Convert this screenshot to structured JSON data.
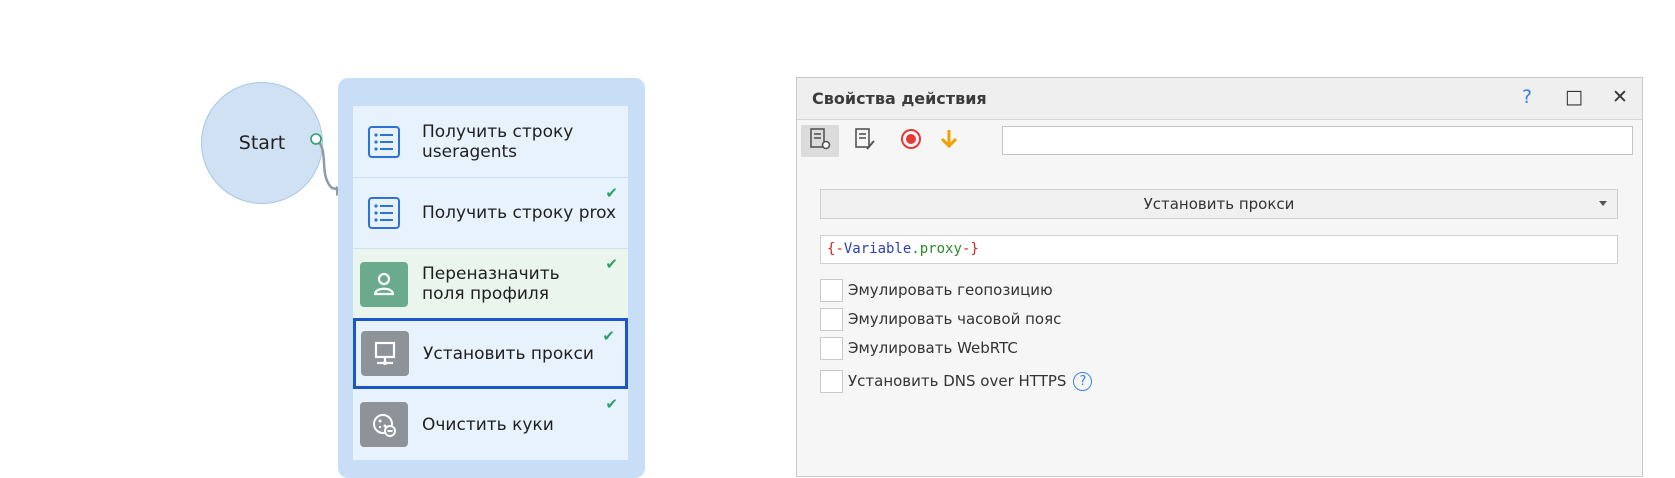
{
  "start": {
    "label": "Start"
  },
  "actions": [
    {
      "label": "Получить строку useragents",
      "icon": "list-icon",
      "checked": false
    },
    {
      "label": "Получить строку prox",
      "icon": "list-icon",
      "checked": true
    },
    {
      "label": "Переназначить поля профиля",
      "icon": "user-icon",
      "checked": true
    },
    {
      "label": "Установить прокси",
      "icon": "monitor-network-icon",
      "checked": true,
      "selected": true
    },
    {
      "label": "Очистить куки",
      "icon": "cookie-icon",
      "checked": true
    }
  ],
  "panel": {
    "title": "Свойства действия",
    "titlebar_buttons": [
      "?",
      "□",
      "✕"
    ],
    "toolbar_input": "",
    "action_select": "Установить прокси",
    "variable": {
      "open": "{-",
      "name": "Variable",
      "dot": ".",
      "prop": "proxy",
      "close": "-}"
    },
    "checkboxes": [
      {
        "label": "Эмулировать геопозицию",
        "checked": false
      },
      {
        "label": "Эмулировать часовой пояс",
        "checked": false
      },
      {
        "label": "Эмулировать WebRTC",
        "checked": false
      },
      {
        "label": "Установить DNS over HTTPS",
        "checked": false,
        "help": "?"
      }
    ]
  },
  "colors": {
    "accent": "#1a56c9",
    "check": "#2aa36a",
    "record": "#e53935",
    "down_arrow": "#f0a000"
  }
}
